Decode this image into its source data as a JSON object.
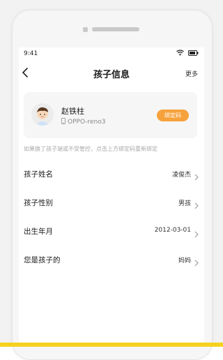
{
  "status_bar": {
    "time": "9:41"
  },
  "header": {
    "title": "孩子信息",
    "more_label": "更多"
  },
  "child_card": {
    "name": "赵铁柱",
    "device": "OPPO-reno3",
    "bind_button": "绑定码"
  },
  "hint_text": "如果换了孩子端或不受管控，点击上方绑定码重新绑定",
  "info_rows": [
    {
      "label": "孩子姓名",
      "value": "凌俊杰"
    },
    {
      "label": "孩子性别",
      "value": "男孩"
    },
    {
      "label": "出生年月",
      "value": "2012-03-01"
    },
    {
      "label": "您是孩子的",
      "value": "妈妈"
    }
  ],
  "colors": {
    "accent": "#f6a23c",
    "bottom_bar": "#f5d21f"
  }
}
